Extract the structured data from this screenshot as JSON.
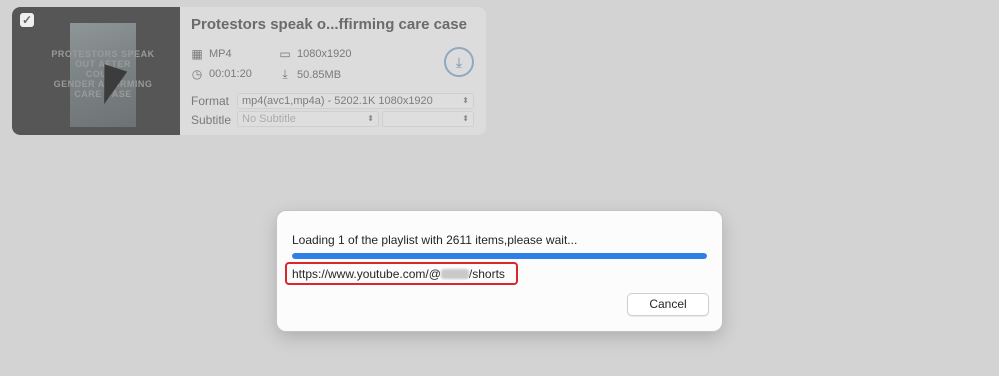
{
  "video": {
    "title": "Protestors speak o...ffirming care case",
    "checked_mark": "✓",
    "thumb_lines": [
      "PROTESTORS SPEAK",
      "OUT AFTER",
      "COURT",
      "GENDER AFFIRMING",
      "CARE CASE"
    ],
    "format_type": "MP4",
    "resolution": "1080x1920",
    "duration": "00:01:20",
    "file_size": "50.85MB",
    "format_label": "Format",
    "format_value": "mp4(avc1,mp4a) - 5202.1K 1080x1920",
    "subtitle_label": "Subtitle",
    "subtitle_value": "No Subtitle",
    "subtitle_value2": ""
  },
  "dialog": {
    "message": "Loading 1 of the playlist with 2611 items,please wait...",
    "progress": 1.0,
    "url_prefix": "https://www.youtube.com/@",
    "url_suffix": "/shorts",
    "cancel_label": "Cancel"
  },
  "colors": {
    "accent": "#2f7fe8",
    "highlight": "#d9262f",
    "overlay": "#d3d3d3"
  },
  "icons": [
    "film-icon",
    "clock-icon",
    "monitor-icon",
    "download-size-icon",
    "download-icon",
    "chevron-updown-icon"
  ]
}
